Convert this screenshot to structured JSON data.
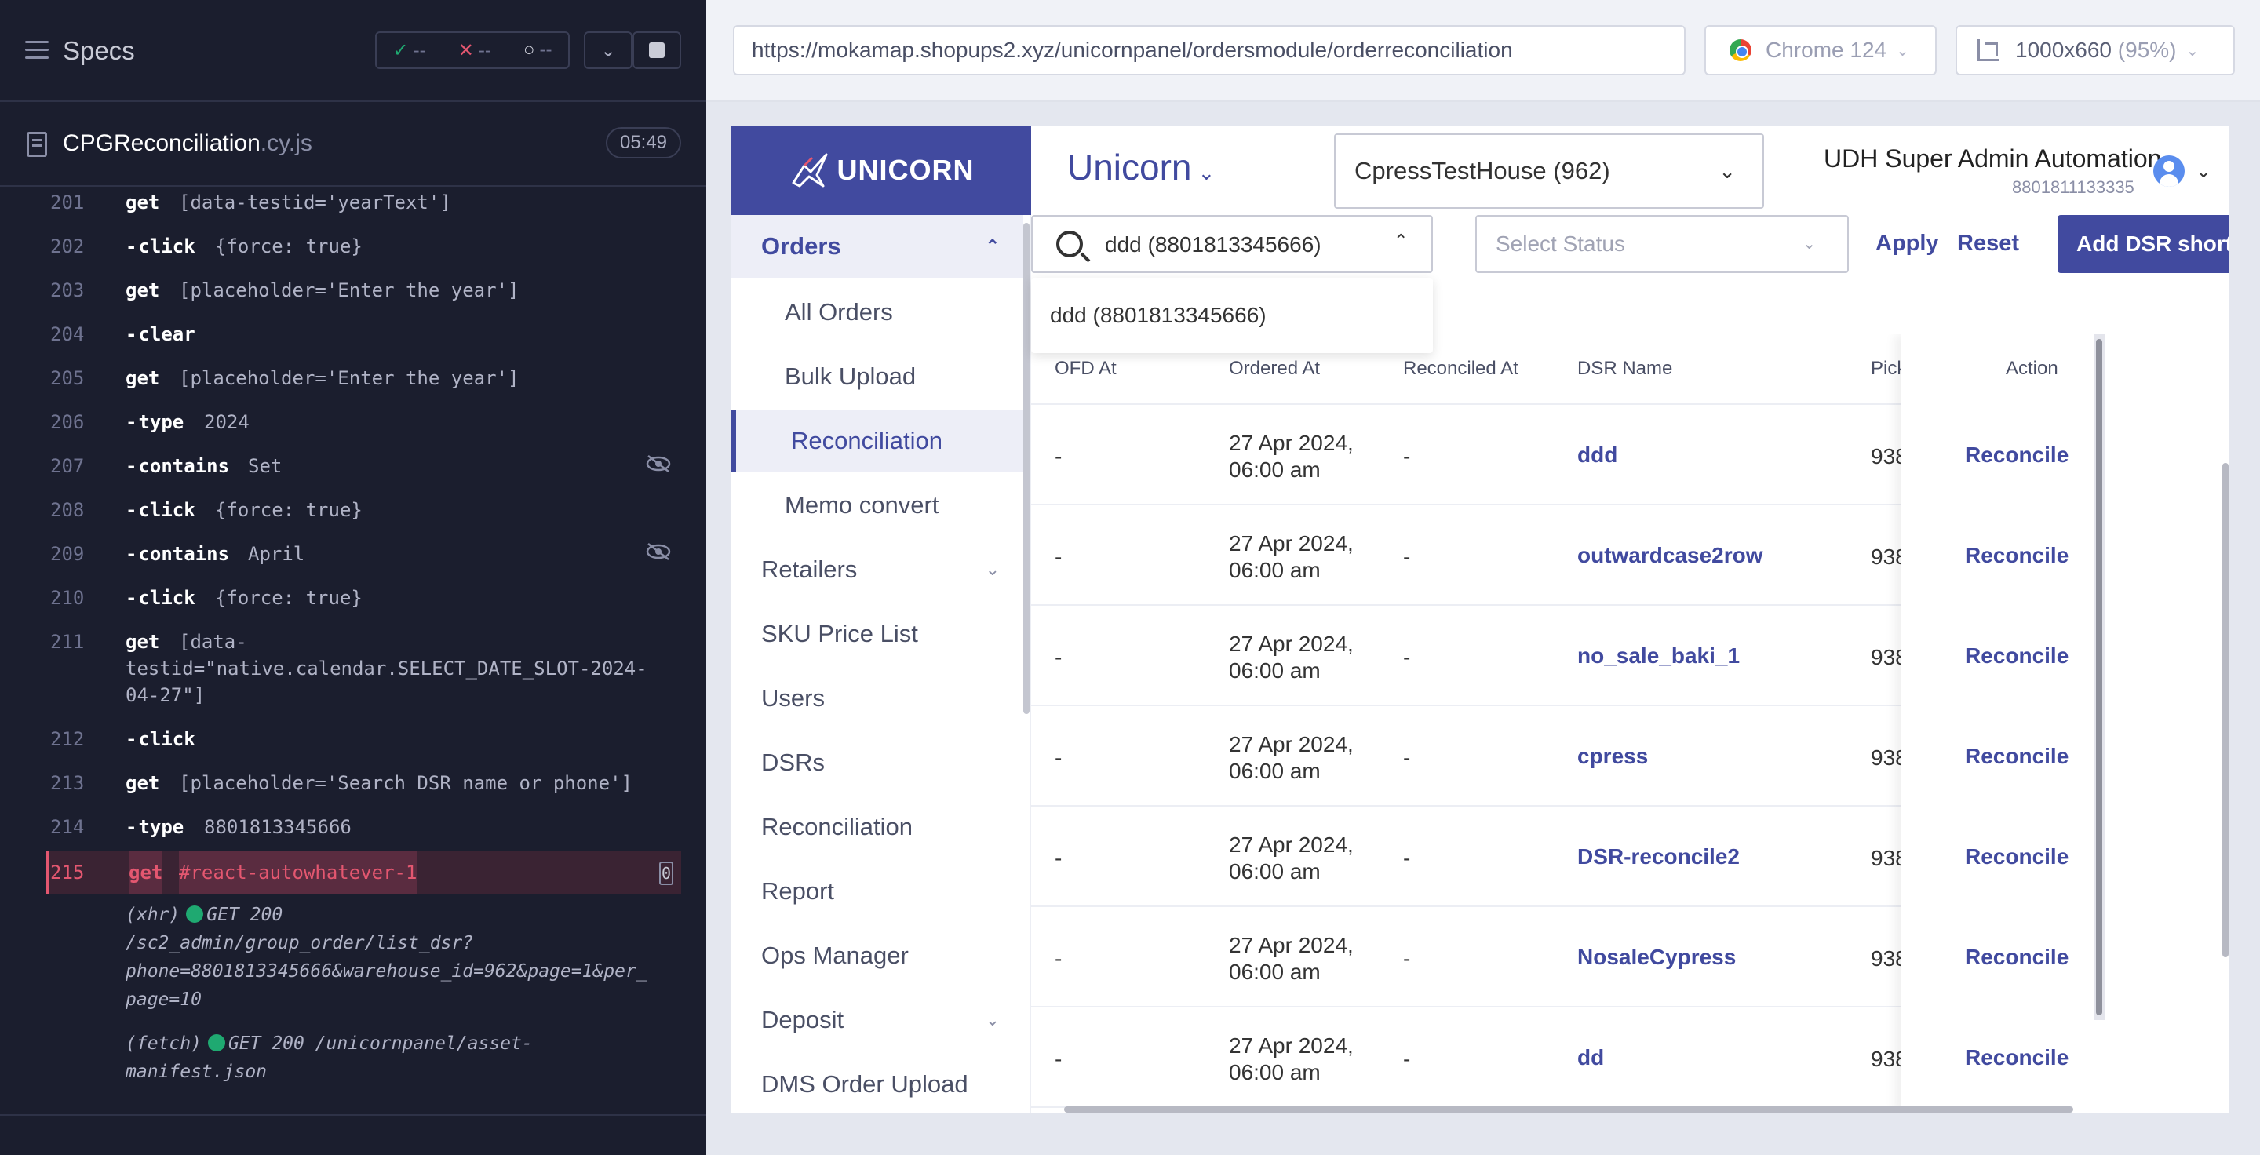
{
  "runner": {
    "specs_label": "Specs",
    "stats": {
      "passed": "--",
      "failed": "--",
      "pending": "--"
    },
    "spec_file": {
      "name": "CPGReconciliation",
      "ext": ".cy.js",
      "duration": "05:49"
    },
    "commands": [
      {
        "num": "201",
        "name": "get",
        "child": false,
        "arg": "[data-testid='yearText']"
      },
      {
        "num": "202",
        "name": "click",
        "child": true,
        "arg": "{force: true}"
      },
      {
        "num": "203",
        "name": "get",
        "child": false,
        "arg": "[placeholder='Enter the year']"
      },
      {
        "num": "204",
        "name": "clear",
        "child": true,
        "arg": ""
      },
      {
        "num": "205",
        "name": "get",
        "child": false,
        "arg": "[placeholder='Enter the year']"
      },
      {
        "num": "206",
        "name": "type",
        "child": true,
        "arg": "2024"
      },
      {
        "num": "207",
        "name": "contains",
        "child": true,
        "arg": "Set"
      },
      {
        "num": "208",
        "name": "click",
        "child": true,
        "arg": "{force: true}"
      },
      {
        "num": "209",
        "name": "contains",
        "child": true,
        "arg": "April"
      },
      {
        "num": "210",
        "name": "click",
        "child": true,
        "arg": "{force: true}"
      },
      {
        "num": "211",
        "name": "get",
        "child": false,
        "arg": "[data-",
        "arg2": "testid=\"native.calendar.SELECT_DATE_SLOT-2024-",
        "arg3": "04-27\"]"
      },
      {
        "num": "212",
        "name": "click",
        "child": true,
        "arg": ""
      },
      {
        "num": "213",
        "name": "get",
        "child": false,
        "arg": "[placeholder='Search DSR name or phone']"
      },
      {
        "num": "214",
        "name": "type",
        "child": true,
        "arg": "8801813345666"
      },
      {
        "num": "215",
        "name": "get",
        "child": false,
        "arg": "#react-autowhatever-1",
        "count": "0"
      }
    ],
    "logs": [
      {
        "type": "(xhr)",
        "method": "GET 200",
        "line1": "/sc2_admin/group_order/list_dsr?",
        "line2": "phone=8801813345666&warehouse_id=962&page=1&per_",
        "line3": "page=10"
      },
      {
        "type": "(fetch)",
        "method": "GET 200 /unicornpanel/asset-",
        "line1": "manifest.json"
      }
    ]
  },
  "browser": {
    "url": "https://mokamap.shopups2.xyz/unicornpanel/ordersmodule/orderreconciliation",
    "name": "Chrome 124",
    "viewport": "1000x660",
    "zoom": "(95%)"
  },
  "app": {
    "logo_text": "UNICORN",
    "brand": "Unicorn",
    "warehouse": "CpressTestHouse (962)",
    "user_name": "UDH Super Admin Automation",
    "user_phone": "8801811133335",
    "sidebar": {
      "orders": "Orders",
      "sub": [
        "All Orders",
        "Bulk Upload",
        "Reconciliation",
        "Memo convert"
      ],
      "items": [
        "Retailers",
        "SKU Price List",
        "Users",
        "DSRs",
        "Reconciliation",
        "Report",
        "Ops Manager",
        "Deposit",
        "DMS Order Upload"
      ]
    },
    "filters": {
      "search_value": "ddd (8801813345666)",
      "suggestion": "ddd (8801813345666)",
      "status_placeholder": "Select Status",
      "apply": "Apply",
      "reset": "Reset",
      "add": "Add DSR short c"
    },
    "table": {
      "headers": {
        "ofd": "OFD At",
        "ordered": "Ordered At",
        "reconciled": "Reconciled At",
        "dsr": "DSR Name",
        "pick": "Pick",
        "action": "Action"
      },
      "rows": [
        {
          "ofd": "-",
          "date1": "27 Apr 2024,",
          "date2": "06:00 am",
          "reconciled": "-",
          "dsr": "ddd",
          "pick": "938",
          "action": "Reconcile"
        },
        {
          "ofd": "-",
          "date1": "27 Apr 2024,",
          "date2": "06:00 am",
          "reconciled": "-",
          "dsr": "outwardcase2row",
          "pick": "938",
          "action": "Reconcile"
        },
        {
          "ofd": "-",
          "date1": "27 Apr 2024,",
          "date2": "06:00 am",
          "reconciled": "-",
          "dsr": "no_sale_baki_1",
          "pick": "938",
          "action": "Reconcile"
        },
        {
          "ofd": "-",
          "date1": "27 Apr 2024,",
          "date2": "06:00 am",
          "reconciled": "-",
          "dsr": "cpress",
          "pick": "938",
          "action": "Reconcile"
        },
        {
          "ofd": "-",
          "date1": "27 Apr 2024,",
          "date2": "06:00 am",
          "reconciled": "-",
          "dsr": "DSR-reconcile2",
          "pick": "938",
          "action": "Reconcile"
        },
        {
          "ofd": "-",
          "date1": "27 Apr 2024,",
          "date2": "06:00 am",
          "reconciled": "-",
          "dsr": "NosaleCypress",
          "pick": "938",
          "action": "Reconcile"
        },
        {
          "ofd": "-",
          "date1": "27 Apr 2024,",
          "date2": "06:00 am",
          "reconciled": "-",
          "dsr": "dd",
          "pick": "938",
          "action": "Reconcile"
        }
      ]
    }
  },
  "colors": {
    "accent": "#414a9f",
    "runner_bg": "#1b1e2e",
    "pass": "#1fa971",
    "fail": "#e45770"
  }
}
